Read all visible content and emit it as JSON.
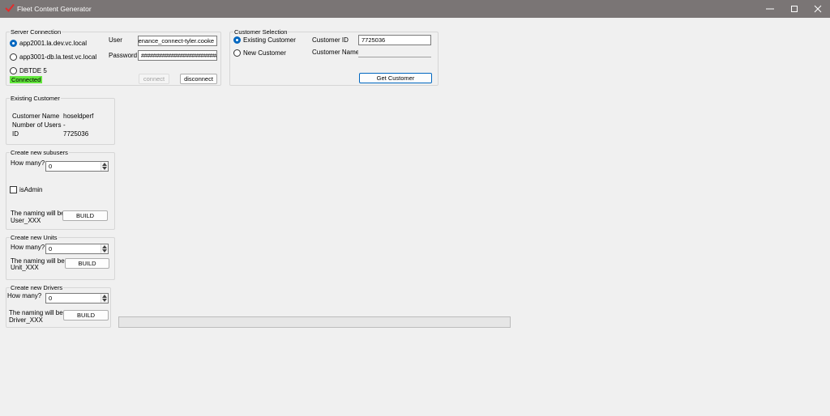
{
  "window": {
    "title": "Fleet Content Generator",
    "controls": [
      "minimize-icon",
      "maximize-icon",
      "close-icon"
    ]
  },
  "server_connection": {
    "title": "Server Connection",
    "servers": [
      {
        "label": "app2001.la.dev.vc.local",
        "selected": true
      },
      {
        "label": "app3001-db.la.test.vc.local",
        "selected": false
      },
      {
        "label": "DBTDE 5",
        "selected": false
      }
    ],
    "user_label": "User",
    "user_value": "maintenance_connect-tyler.cooke",
    "password_label": "Password",
    "password_value": "##############################",
    "status": "Connected",
    "connect_label": "connect",
    "disconnect_label": "disconnect"
  },
  "customer_selection": {
    "title": "Customer Selection",
    "existing_label": "Existing Customer",
    "new_label": "New Customer",
    "selected": "existing",
    "customer_id_label": "Customer ID",
    "customer_id_value": "7725036",
    "customer_name_label": "Customer Name",
    "customer_name_value": "",
    "get_customer_label": "Get Customer"
  },
  "existing_customer": {
    "title": "Existing Customer",
    "name_label": "Customer Name",
    "name_value": "hoseldperf",
    "users_label": "Number of Users",
    "users_value": "-",
    "id_label": "ID",
    "id_value": "7725036"
  },
  "subusers": {
    "title": "Create new subusers",
    "how_many_label": "How many?",
    "how_many_value": "0",
    "is_admin_label": "isAdmin",
    "is_admin_checked": false,
    "naming_line1": "The naming will be:",
    "naming_line2": "User_XXX",
    "build_label": "BUILD"
  },
  "units": {
    "title": "Create new Units",
    "how_many_label": "How many?",
    "how_many_value": "0",
    "naming_line1": "The naming will be:",
    "naming_line2": "Unit_XXX",
    "build_label": "BUILD"
  },
  "drivers": {
    "title": "Create new Drivers",
    "how_many_label": "How many?",
    "how_many_value": "0",
    "naming_line1": "The naming will be:",
    "naming_line2": "Driver_XXX",
    "build_label": "BUILD"
  },
  "progress": {
    "percent": 0
  },
  "colors": {
    "titlebar": "#7a7575",
    "accent": "#0067c0",
    "connected": "#63e63d",
    "progress_fill": "#06b025"
  }
}
